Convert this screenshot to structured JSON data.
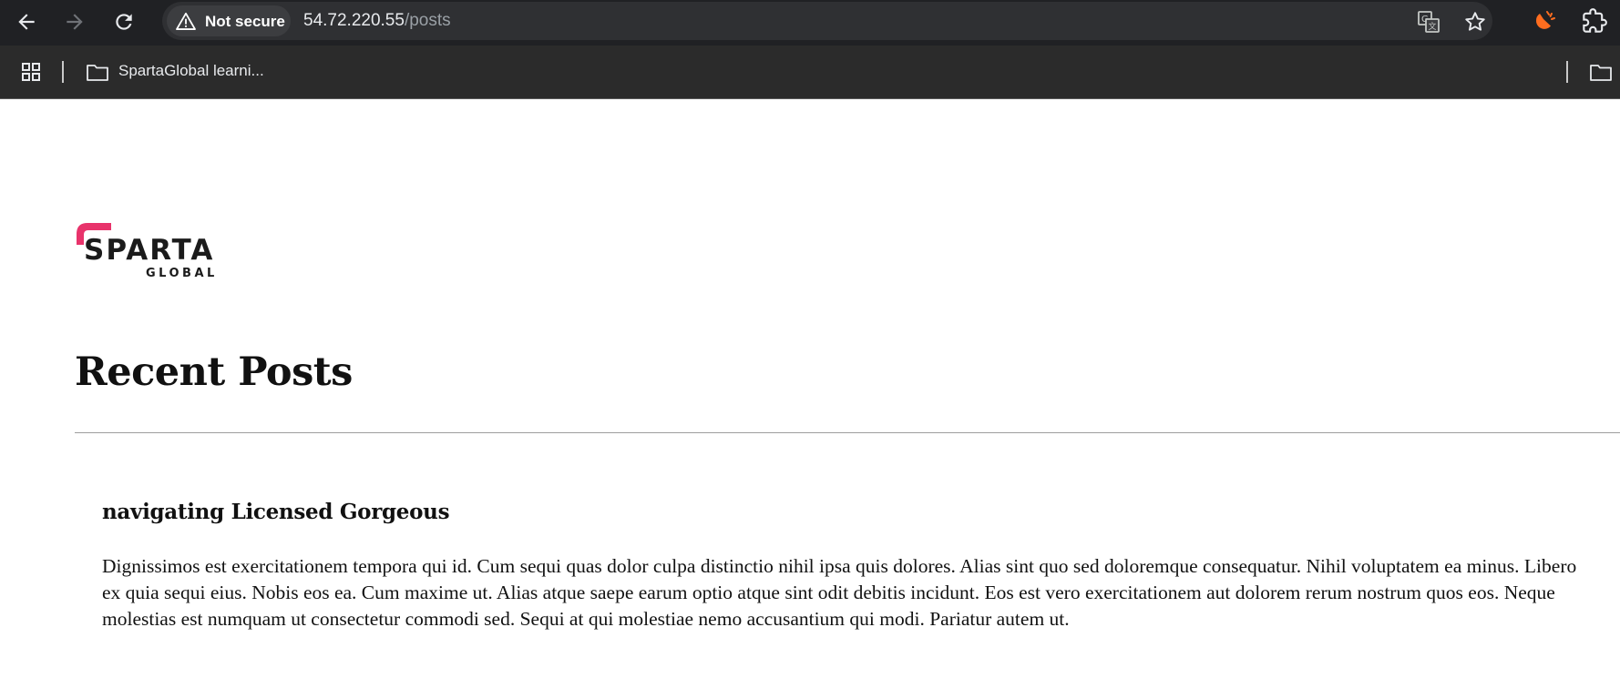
{
  "browser": {
    "security_label": "Not secure",
    "url_host": "54.72.220.55",
    "url_path": "/posts",
    "bookmark_folder": "SpartaGlobal learni..."
  },
  "logo": {
    "line1": "SPARTA",
    "line2": "GLOBAL",
    "accent_color": "#e8336b"
  },
  "page": {
    "heading": "Recent Posts"
  },
  "posts": [
    {
      "title": "navigating Licensed Gorgeous",
      "body": "Dignissimos est exercitationem tempora qui id. Cum sequi quas dolor culpa distinctio nihil ipsa quis dolores. Alias sint quo sed doloremque consequatur. Nihil voluptatem ea minus. Libero ex quia sequi eius. Nobis eos ea. Cum maxime ut. Alias atque saepe earum optio atque sint odit debitis incidunt. Eos est vero exercitationem aut dolorem rerum nostrum quos eos. Neque molestias est numquam ut consectetur commodi sed. Sequi at qui molestiae nemo accusantium qui modi. Pariatur autem ut."
    }
  ],
  "icons": [
    "back-arrow-icon",
    "forward-arrow-icon",
    "reload-icon",
    "warning-icon",
    "translate-icon",
    "star-icon",
    "extension-badge-icon",
    "puzzle-icon",
    "apps-grid-icon",
    "folder-icon"
  ]
}
